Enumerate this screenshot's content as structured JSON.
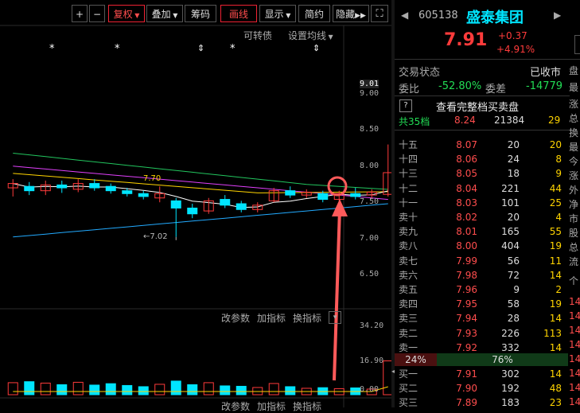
{
  "toolbar": {
    "plus": "+",
    "minus": "−",
    "fuquan": "复权",
    "diejia": "叠加",
    "chouma": "筹码",
    "huaxian": "画线",
    "xianshi": "显示",
    "jianyue": "简约",
    "yincang": "隐藏",
    "fullscreen": "⛶"
  },
  "chart": {
    "kezhuanzhai": "可转债",
    "shezhi_junxian": "设置均线",
    "ma_label": "7.70",
    "low_label": "7.02",
    "y_ticks": [
      "9.01",
      "9.00",
      "8.50",
      "8.00",
      "7.50",
      "7.00",
      "6.50"
    ],
    "vol_ticks": [
      "34.20",
      "16.90",
      "0.00"
    ],
    "sub_buttons": {
      "gaicanshu": "改参数",
      "jiazhibiao": "加指标",
      "huanzhibiao": "换指标"
    },
    "sub_buttons2": {
      "gaicanshu": "改参数",
      "jiazhibiao": "加指标",
      "huanzhibiao": "换指标"
    },
    "markers": [
      "*",
      "*",
      "⇕",
      "*",
      "⇕"
    ],
    "price_scale": {
      "min": 6.3,
      "max": 9.1
    },
    "candles": [
      {
        "o": 7.7,
        "c": 7.76,
        "h": 7.82,
        "l": 7.58,
        "v": 6.0
      },
      {
        "o": 7.72,
        "c": 7.66,
        "h": 7.78,
        "l": 7.6,
        "v": 6.5
      },
      {
        "o": 7.66,
        "c": 7.74,
        "h": 7.8,
        "l": 7.6,
        "v": 5.8
      },
      {
        "o": 7.74,
        "c": 7.7,
        "h": 7.8,
        "l": 7.63,
        "v": 5.0
      },
      {
        "o": 7.68,
        "c": 7.76,
        "h": 7.82,
        "l": 7.64,
        "v": 6.2
      },
      {
        "o": 7.76,
        "c": 7.7,
        "h": 7.82,
        "l": 7.66,
        "v": 4.8
      },
      {
        "o": 7.72,
        "c": 7.66,
        "h": 7.76,
        "l": 7.62,
        "v": 5.5
      },
      {
        "o": 7.66,
        "c": 7.62,
        "h": 7.7,
        "l": 7.58,
        "v": 4.6
      },
      {
        "o": 7.62,
        "c": 7.58,
        "h": 7.66,
        "l": 7.54,
        "v": 4.0
      },
      {
        "o": 7.56,
        "c": 7.62,
        "h": 7.72,
        "l": 7.5,
        "v": 5.2
      },
      {
        "o": 7.52,
        "c": 7.42,
        "h": 7.56,
        "l": 7.02,
        "v": 6.8
      },
      {
        "o": 7.42,
        "c": 7.34,
        "h": 7.48,
        "l": 7.28,
        "v": 5.0
      },
      {
        "o": 7.38,
        "c": 7.52,
        "h": 7.56,
        "l": 7.34,
        "v": 6.0
      },
      {
        "o": 7.54,
        "c": 7.46,
        "h": 7.6,
        "l": 7.42,
        "v": 4.4
      },
      {
        "o": 7.48,
        "c": 7.4,
        "h": 7.52,
        "l": 7.36,
        "v": 4.2
      },
      {
        "o": 7.4,
        "c": 7.46,
        "h": 7.5,
        "l": 7.36,
        "v": 3.6
      },
      {
        "o": 7.52,
        "c": 7.66,
        "h": 7.7,
        "l": 7.5,
        "v": 5.6
      },
      {
        "o": 7.66,
        "c": 7.6,
        "h": 7.72,
        "l": 7.56,
        "v": 4.0
      },
      {
        "o": 7.6,
        "c": 7.64,
        "h": 7.68,
        "l": 7.56,
        "v": 3.2
      },
      {
        "o": 7.62,
        "c": 7.54,
        "h": 7.66,
        "l": 7.5,
        "v": 3.5
      },
      {
        "o": 7.54,
        "c": 7.62,
        "h": 7.66,
        "l": 7.52,
        "v": 3.0
      },
      {
        "o": 7.62,
        "c": 7.58,
        "h": 7.7,
        "l": 7.54,
        "v": 3.4
      },
      {
        "o": 7.6,
        "c": 7.64,
        "h": 7.68,
        "l": 7.56,
        "v": 2.8
      },
      {
        "o": 7.61,
        "c": 7.91,
        "h": 8.3,
        "l": 7.58,
        "v": 16.9
      }
    ]
  },
  "quote": {
    "prev_arrow": "◀",
    "next_arrow": "▶",
    "code": "605138",
    "name": "盛泰集团",
    "price": "7.91",
    "change": "+0.37",
    "change_pct": "+4.91%",
    "trade_status_label": "交易状态",
    "trade_status": "已收市",
    "webi_label": "委比",
    "webi": "-52.80%",
    "weicha_label": "委差",
    "weicha": "-14779",
    "help": "?",
    "full_book": "查看完整档买卖盘",
    "levels_label": "共35档",
    "levels_price": "8.24",
    "levels_vol": "21384",
    "levels_cnt": "29",
    "ratio_left": "24%",
    "ratio_right": "76%",
    "side_labels": [
      "盘",
      "最",
      "涨",
      "总",
      "换",
      "最",
      "今",
      "涨",
      "外",
      "净",
      "市",
      "股",
      "总",
      "流",
      "个",
      "14",
      "14",
      "14",
      "14",
      "14",
      "14",
      "14",
      "14"
    ]
  },
  "asks": [
    {
      "n": "十五",
      "p": "8.07",
      "v": "20",
      "c": "20"
    },
    {
      "n": "十四",
      "p": "8.06",
      "v": "24",
      "c": "8"
    },
    {
      "n": "十三",
      "p": "8.05",
      "v": "18",
      "c": "9"
    },
    {
      "n": "十二",
      "p": "8.04",
      "v": "221",
      "c": "44"
    },
    {
      "n": "十一",
      "p": "8.03",
      "v": "101",
      "c": "25"
    },
    {
      "n": "卖十",
      "p": "8.02",
      "v": "20",
      "c": "4"
    },
    {
      "n": "卖九",
      "p": "8.01",
      "v": "165",
      "c": "55"
    },
    {
      "n": "卖八",
      "p": "8.00",
      "v": "404",
      "c": "19"
    },
    {
      "n": "卖七",
      "p": "7.99",
      "v": "56",
      "c": "11"
    },
    {
      "n": "卖六",
      "p": "7.98",
      "v": "72",
      "c": "14"
    },
    {
      "n": "卖五",
      "p": "7.96",
      "v": "9",
      "c": "2"
    },
    {
      "n": "卖四",
      "p": "7.95",
      "v": "58",
      "c": "19"
    },
    {
      "n": "卖三",
      "p": "7.94",
      "v": "28",
      "c": "14"
    },
    {
      "n": "卖二",
      "p": "7.93",
      "v": "226",
      "c": "113"
    },
    {
      "n": "卖一",
      "p": "7.92",
      "v": "332",
      "c": "14"
    }
  ],
  "bids": [
    {
      "n": "买一",
      "p": "7.91",
      "v": "302",
      "c": "14"
    },
    {
      "n": "买二",
      "p": "7.90",
      "v": "192",
      "c": "48"
    },
    {
      "n": "买三",
      "p": "7.89",
      "v": "183",
      "c": "23"
    }
  ],
  "colors": {
    "up": "#ff3b3b",
    "down": "#00e5ff",
    "ma5": "#ffffff",
    "ma10": "#ffd400",
    "ma20": "#e040fb",
    "ma30": "#22c55e",
    "ma60": "#22aaff"
  }
}
